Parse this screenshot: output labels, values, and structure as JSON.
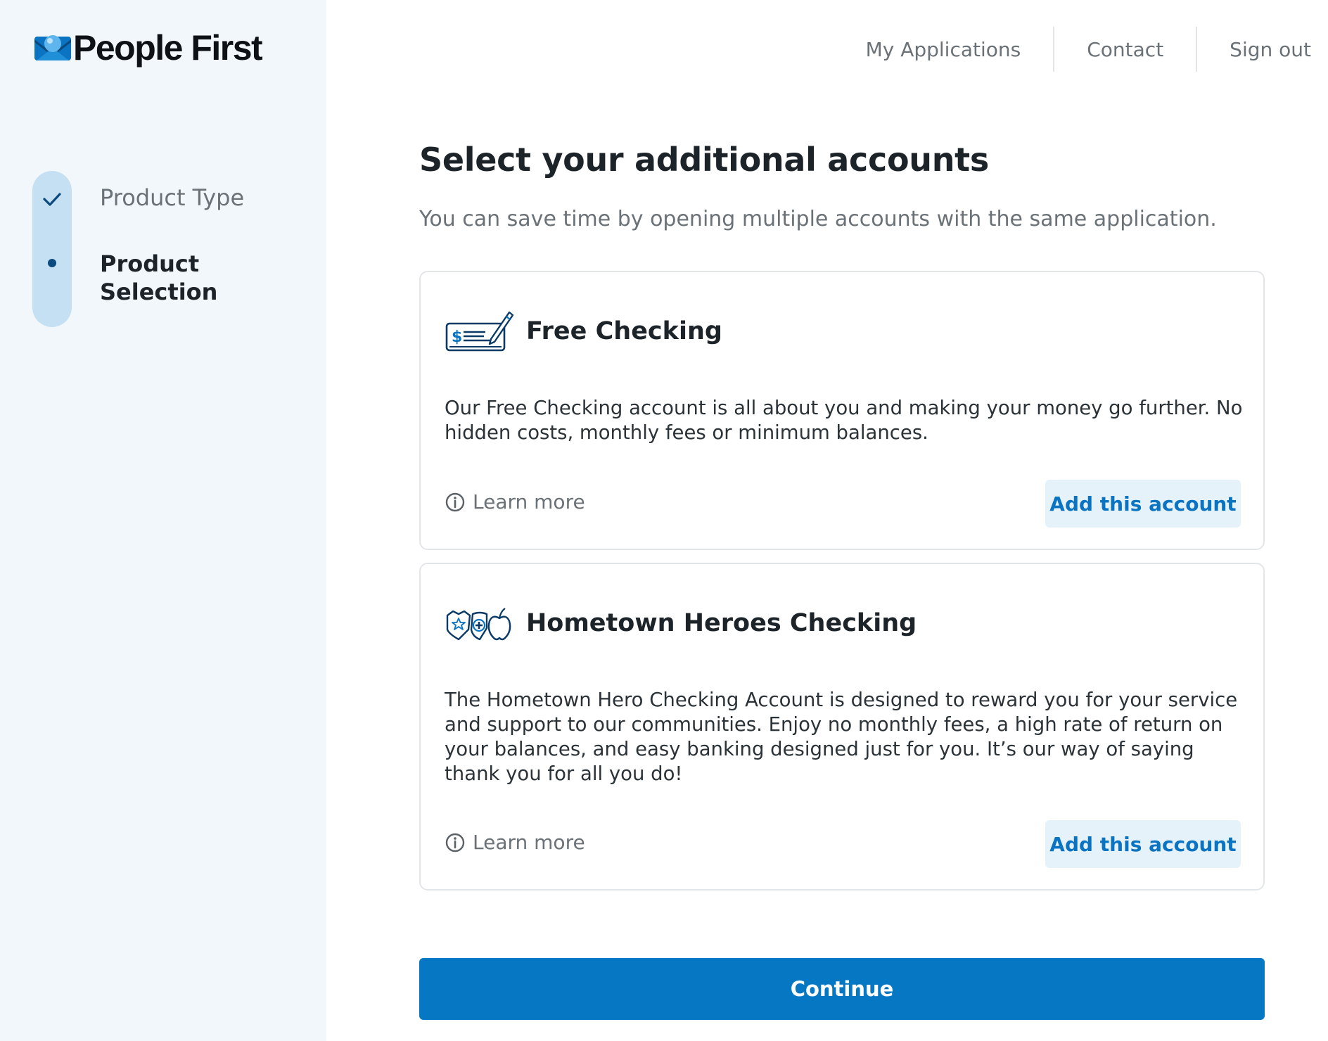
{
  "brand": {
    "name": "People First",
    "logo_icon": "heart-envelope-logo-icon"
  },
  "nav": {
    "items": [
      "My Applications",
      "Contact",
      "Sign out"
    ]
  },
  "stepper": {
    "steps": [
      {
        "label": "Product Type",
        "status": "completed",
        "icon": "check-icon"
      },
      {
        "label": "Product Selection",
        "status": "current",
        "icon": "dot-icon"
      }
    ]
  },
  "main": {
    "title": "Select your additional accounts",
    "subtitle": "You can save time by opening multiple accounts with the same application."
  },
  "accounts": [
    {
      "icon": "check-pen-icon",
      "title": "Free Checking",
      "description": "Our Free Checking account is all about you and making your money go further. No hidden costs, monthly fees or minimum balances.",
      "learn_more": "Learn more",
      "add_label": "Add this account"
    },
    {
      "icon": "heroes-badge-shield-apple-icon",
      "title": "Hometown Heroes Checking",
      "description": "The Hometown Hero Checking Account is designed to reward you for your service and support to our communities. Enjoy no monthly fees, a high rate of return on your balances, and easy banking designed just for you. It’s our way of saying thank you for all you do!",
      "learn_more": "Learn more",
      "add_label": "Add this account"
    }
  ],
  "continue_label": "Continue",
  "colors": {
    "accent": "#0677c3",
    "sidebar_bg": "#f2f7fb",
    "stepper_track": "#c6e0f3",
    "add_button_bg": "#e6f2fa"
  }
}
